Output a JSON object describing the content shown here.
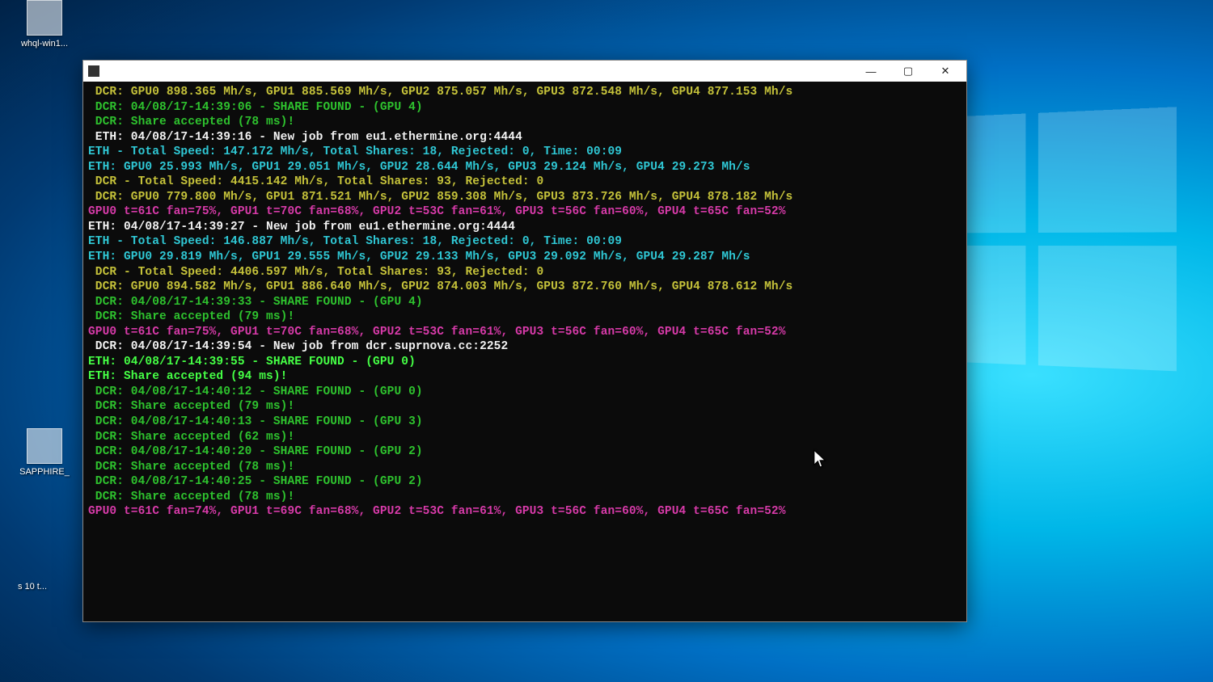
{
  "desktop": {
    "icons": [
      {
        "label": "whql-win1..."
      },
      {
        "label": "SAPPHIRE_"
      },
      {
        "label": "s 10\nt..."
      }
    ]
  },
  "window": {
    "title": ""
  },
  "colors": {
    "yellow": "#c5c23a",
    "green": "#2ec22e",
    "bright_green": "#45ff45",
    "white": "#f2f2f2",
    "cyan": "#2fc7d4",
    "magenta": "#d63aa8"
  },
  "console": {
    "lines": [
      {
        "cls": "c-yellow",
        "text": " DCR: GPU0 898.365 Mh/s, GPU1 885.569 Mh/s, GPU2 875.057 Mh/s, GPU3 872.548 Mh/s, GPU4 877.153 Mh/s"
      },
      {
        "cls": "c-green",
        "text": " DCR: 04/08/17-14:39:06 - SHARE FOUND - (GPU 4)"
      },
      {
        "cls": "c-green",
        "text": " DCR: Share accepted (78 ms)!"
      },
      {
        "cls": "c-white",
        "text": " ETH: 04/08/17-14:39:16 - New job from eu1.ethermine.org:4444"
      },
      {
        "cls": "c-cyan",
        "text": "ETH - Total Speed: 147.172 Mh/s, Total Shares: 18, Rejected: 0, Time: 00:09"
      },
      {
        "cls": "c-cyan",
        "text": "ETH: GPU0 25.993 Mh/s, GPU1 29.051 Mh/s, GPU2 28.644 Mh/s, GPU3 29.124 Mh/s, GPU4 29.273 Mh/s"
      },
      {
        "cls": "c-yellow",
        "text": " DCR - Total Speed: 4415.142 Mh/s, Total Shares: 93, Rejected: 0"
      },
      {
        "cls": "c-yellow",
        "text": " DCR: GPU0 779.800 Mh/s, GPU1 871.521 Mh/s, GPU2 859.308 Mh/s, GPU3 873.726 Mh/s, GPU4 878.182 Mh/s"
      },
      {
        "cls": "c-magenta",
        "text": "GPU0 t=61C fan=75%, GPU1 t=70C fan=68%, GPU2 t=53C fan=61%, GPU3 t=56C fan=60%, GPU4 t=65C fan=52%"
      },
      {
        "cls": "c-white",
        "text": "ETH: 04/08/17-14:39:27 - New job from eu1.ethermine.org:4444"
      },
      {
        "cls": "c-cyan",
        "text": "ETH - Total Speed: 146.887 Mh/s, Total Shares: 18, Rejected: 0, Time: 00:09"
      },
      {
        "cls": "c-cyan",
        "text": "ETH: GPU0 29.819 Mh/s, GPU1 29.555 Mh/s, GPU2 29.133 Mh/s, GPU3 29.092 Mh/s, GPU4 29.287 Mh/s"
      },
      {
        "cls": "c-yellow",
        "text": " DCR - Total Speed: 4406.597 Mh/s, Total Shares: 93, Rejected: 0"
      },
      {
        "cls": "c-yellow",
        "text": " DCR: GPU0 894.582 Mh/s, GPU1 886.640 Mh/s, GPU2 874.003 Mh/s, GPU3 872.760 Mh/s, GPU4 878.612 Mh/s"
      },
      {
        "cls": "c-green",
        "text": " DCR: 04/08/17-14:39:33 - SHARE FOUND - (GPU 4)"
      },
      {
        "cls": "c-green",
        "text": " DCR: Share accepted (79 ms)!"
      },
      {
        "cls": "c-magenta",
        "text": "GPU0 t=61C fan=75%, GPU1 t=70C fan=68%, GPU2 t=53C fan=61%, GPU3 t=56C fan=60%, GPU4 t=65C fan=52%"
      },
      {
        "cls": "c-white",
        "text": " DCR: 04/08/17-14:39:54 - New job from dcr.suprnova.cc:2252"
      },
      {
        "cls": "c-bgreen",
        "text": "ETH: 04/08/17-14:39:55 - SHARE FOUND - (GPU 0)"
      },
      {
        "cls": "c-bgreen",
        "text": "ETH: Share accepted (94 ms)!"
      },
      {
        "cls": "c-green",
        "text": " DCR: 04/08/17-14:40:12 - SHARE FOUND - (GPU 0)"
      },
      {
        "cls": "c-green",
        "text": " DCR: Share accepted (79 ms)!"
      },
      {
        "cls": "c-green",
        "text": " DCR: 04/08/17-14:40:13 - SHARE FOUND - (GPU 3)"
      },
      {
        "cls": "c-green",
        "text": " DCR: Share accepted (62 ms)!"
      },
      {
        "cls": "c-green",
        "text": " DCR: 04/08/17-14:40:20 - SHARE FOUND - (GPU 2)"
      },
      {
        "cls": "c-green",
        "text": " DCR: Share accepted (78 ms)!"
      },
      {
        "cls": "c-green",
        "text": " DCR: 04/08/17-14:40:25 - SHARE FOUND - (GPU 2)"
      },
      {
        "cls": "c-green",
        "text": " DCR: Share accepted (78 ms)!"
      },
      {
        "cls": "c-magenta",
        "text": "GPU0 t=61C fan=74%, GPU1 t=69C fan=68%, GPU2 t=53C fan=61%, GPU3 t=56C fan=60%, GPU4 t=65C fan=52%"
      }
    ]
  }
}
